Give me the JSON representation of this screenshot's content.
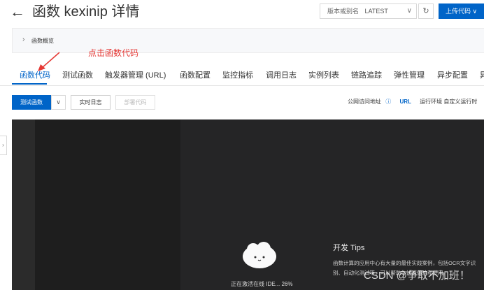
{
  "header": {
    "back_icon": "←",
    "title": "函数 kexinip 详情",
    "version_label": "版本或别名",
    "version_value": "LATEST",
    "refresh_icon": "↻",
    "upload_label": "上传代码 ∨"
  },
  "overview": {
    "label": "函数概览"
  },
  "annotation": {
    "text": "点击函数代码",
    "color": "#e53935"
  },
  "tabs": [
    {
      "label": "函数代码"
    },
    {
      "label": "测试函数"
    },
    {
      "label": "触发器管理 (URL)"
    },
    {
      "label": "函数配置"
    },
    {
      "label": "监控指标"
    },
    {
      "label": "调用日志"
    },
    {
      "label": "实例列表"
    },
    {
      "label": "链路追踪"
    },
    {
      "label": "弹性管理"
    },
    {
      "label": "异步配置"
    },
    {
      "label": "异"
    }
  ],
  "toolbar": {
    "test_label": "测试函数",
    "caret": "∨",
    "log_label": "实时日志",
    "deploy_label": "部署代码",
    "public_url_label": "公网访问地址",
    "help_icon": "ⓘ",
    "url_label": "URL",
    "runtime_label": "运行环境 自定义运行时"
  },
  "ide": {
    "loading_text": "正在激活在线 IDE... 26%",
    "tips_title": "开发 Tips",
    "tips_body": "函数计算的应用中心有大量的最佳实践案例，包括OCR文字识别、自动化测试等，可以帮助你快速体验和使用。"
  },
  "watermark": "CSDN @争取不加班！",
  "colors": {
    "accent": "#0064c8",
    "ide_bg": "#1e1e1e"
  }
}
